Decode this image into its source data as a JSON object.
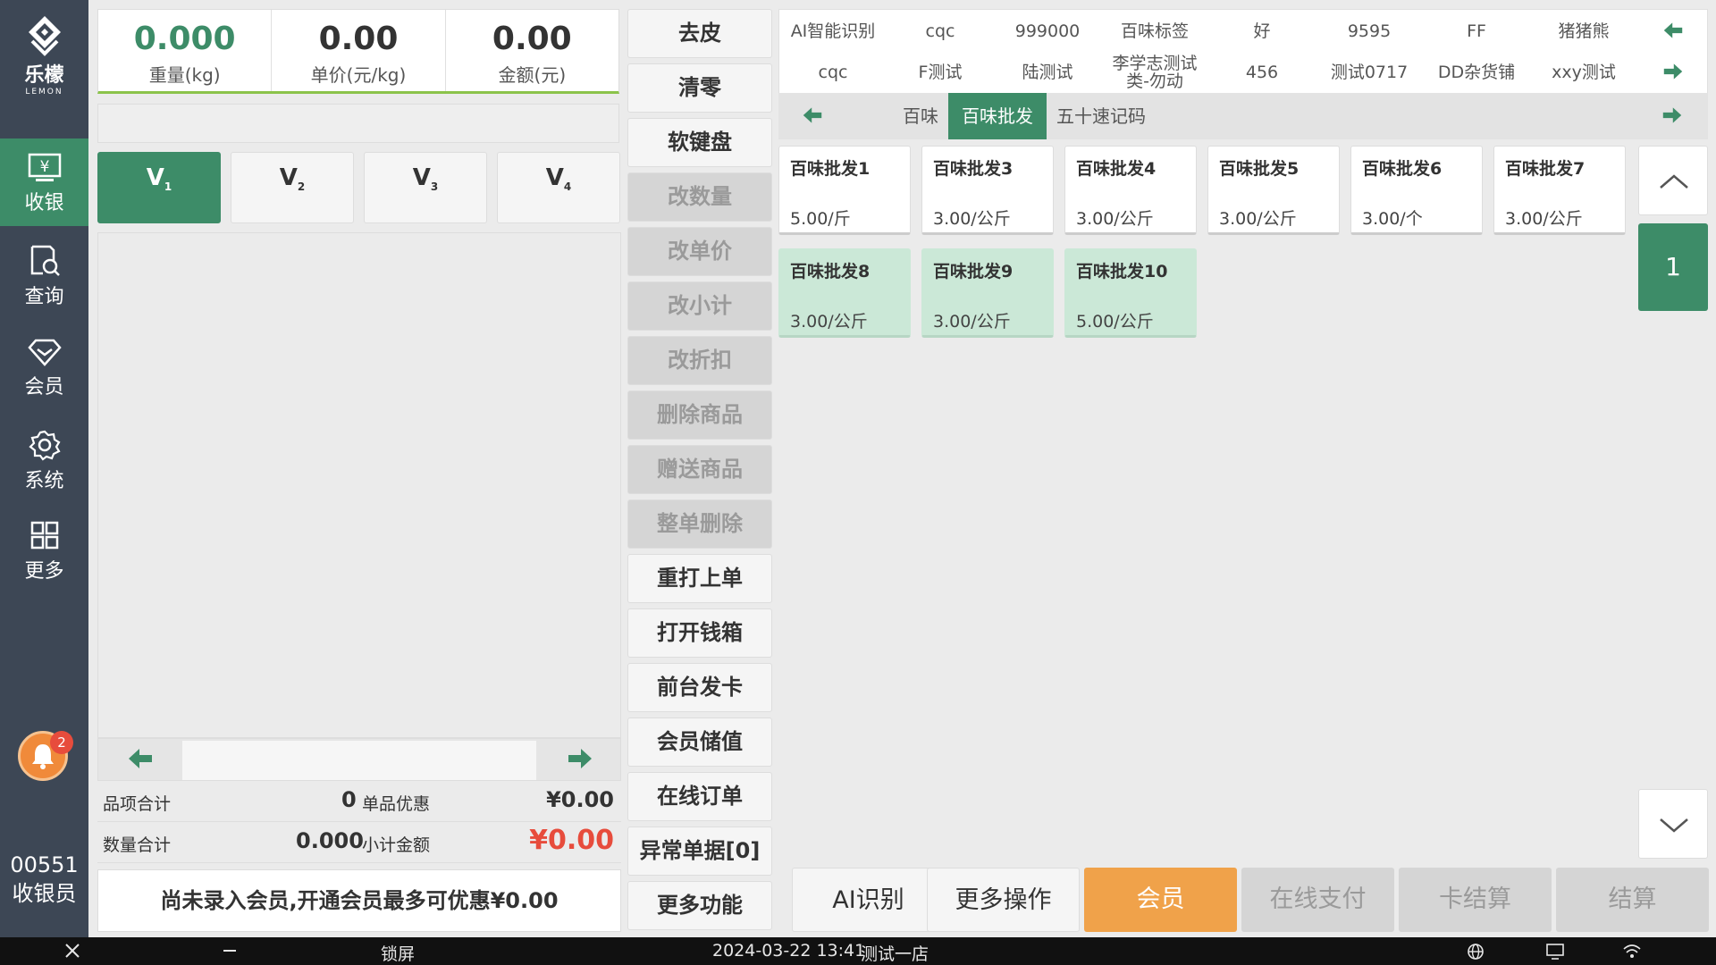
{
  "sidebar": {
    "logo_cn": "乐檬",
    "logo_en": "LEMON",
    "nav": [
      {
        "label": "收银",
        "icon": "cashier-icon"
      },
      {
        "label": "查询",
        "icon": "query-icon"
      },
      {
        "label": "会员",
        "icon": "member-icon"
      },
      {
        "label": "系统",
        "icon": "gear-icon"
      },
      {
        "label": "更多",
        "icon": "grid-icon"
      }
    ],
    "badge_count": "2",
    "operator_id": "00551",
    "operator_role": "收银员"
  },
  "scale": {
    "weight": "0.000",
    "weight_label": "重量(kg)",
    "unit_price": "0.00",
    "unit_price_label": "单价(元/kg)",
    "amount": "0.00",
    "amount_label": "金额(元)"
  },
  "vtabs": [
    {
      "label": "V",
      "sub": "1"
    },
    {
      "label": "V",
      "sub": "2"
    },
    {
      "label": "V",
      "sub": "3"
    },
    {
      "label": "V",
      "sub": "4"
    }
  ],
  "summary": {
    "items_label": "品项合计",
    "items_value": "0",
    "discount_label": "单品优惠",
    "discount_value": "¥0.00",
    "qty_label": "数量合计",
    "qty_value": "0.000",
    "subtotal_label": "小计金额",
    "subtotal_value": "¥0.00"
  },
  "member_banner": "尚未录入会员,开通会员最多可优惠¥0.00",
  "functions": [
    {
      "label": "去皮",
      "enabled": true
    },
    {
      "label": "清零",
      "enabled": true
    },
    {
      "label": "软键盘",
      "enabled": true
    },
    {
      "label": "改数量",
      "enabled": false
    },
    {
      "label": "改单价",
      "enabled": false
    },
    {
      "label": "改小计",
      "enabled": false
    },
    {
      "label": "改折扣",
      "enabled": false
    },
    {
      "label": "删除商品",
      "enabled": false
    },
    {
      "label": "赠送商品",
      "enabled": false
    },
    {
      "label": "整单删除",
      "enabled": false
    },
    {
      "label": "重打上单",
      "enabled": true
    },
    {
      "label": "打开钱箱",
      "enabled": true
    },
    {
      "label": "前台发卡",
      "enabled": true
    },
    {
      "label": "会员储值",
      "enabled": true
    },
    {
      "label": "在线订单",
      "enabled": true
    },
    {
      "label": "异常单据[0]",
      "enabled": true
    },
    {
      "label": "更多功能",
      "enabled": true
    }
  ],
  "categories_row1": [
    "AI智能识别",
    "cqc",
    "999000",
    "百味标签",
    "好",
    "9595",
    "FF",
    "猪猪熊"
  ],
  "categories_row2": [
    "cqc",
    "F测试",
    "陆测试",
    "李学志测试类-勿动",
    "456",
    "测试0717",
    "DD杂货铺",
    "xxy测试"
  ],
  "subcategories": [
    "百味",
    "百味批发",
    "五十速记码"
  ],
  "active_subcategory": "百味批发",
  "products": [
    {
      "name": "百味批发1",
      "price": "5.00/斤"
    },
    {
      "name": "百味批发3",
      "price": "3.00/公斤"
    },
    {
      "name": "百味批发4",
      "price": "3.00/公斤"
    },
    {
      "name": "百味批发5",
      "price": "3.00/公斤"
    },
    {
      "name": "百味批发6",
      "price": "3.00/个"
    },
    {
      "name": "百味批发7",
      "price": "3.00/公斤"
    },
    {
      "name": "百味批发8",
      "price": "3.00/公斤"
    },
    {
      "name": "百味批发9",
      "price": "3.00/公斤"
    },
    {
      "name": "百味批发10",
      "price": "5.00/公斤"
    }
  ],
  "page_number": "1",
  "bottom_buttons": [
    {
      "label": "AI识别",
      "state": "normal"
    },
    {
      "label": "更多操作",
      "state": "normal"
    },
    {
      "label": "会员",
      "state": "orange"
    },
    {
      "label": "在线支付",
      "state": "disabled"
    },
    {
      "label": "卡结算",
      "state": "disabled"
    },
    {
      "label": "结算",
      "state": "disabled"
    }
  ],
  "taskbar": {
    "lock": "锁屏",
    "datetime": "2024-03-22 13:41",
    "store": "测试一店"
  },
  "colors": {
    "primary": "#3d8c68",
    "sidebar": "#3d4755",
    "accent_orange": "#f0a24a",
    "price_red": "#e74c3c"
  }
}
